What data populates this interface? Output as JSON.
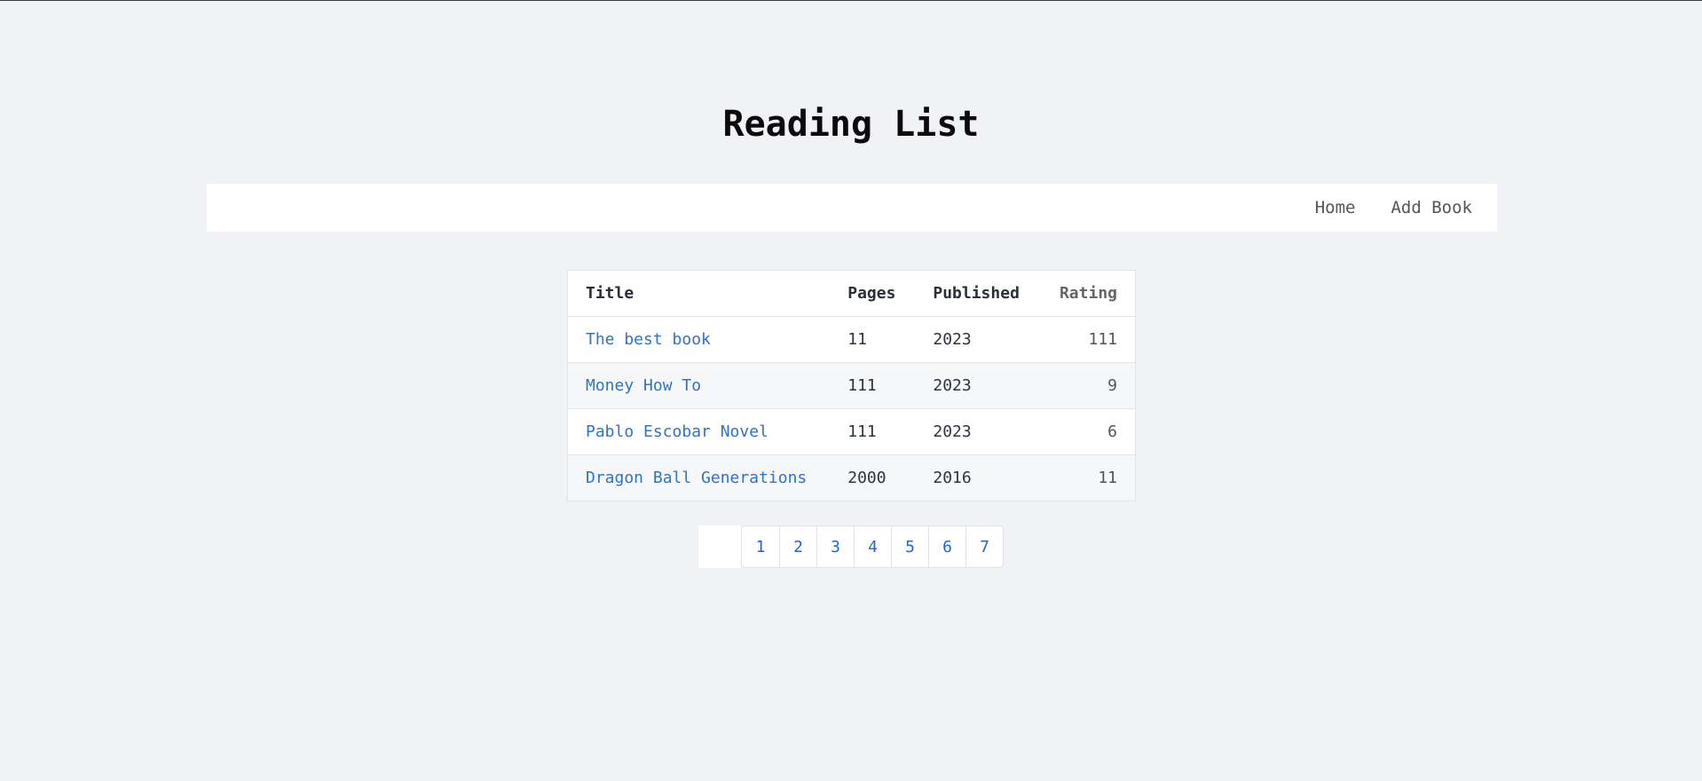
{
  "header": {
    "title": "Reading List"
  },
  "nav": {
    "links": [
      {
        "label": "Home"
      },
      {
        "label": "Add Book"
      }
    ]
  },
  "table": {
    "columns": {
      "title": "Title",
      "pages": "Pages",
      "published": "Published",
      "rating": "Rating"
    },
    "rows": [
      {
        "title": "The best book",
        "pages": "11",
        "published": "2023",
        "rating": "111"
      },
      {
        "title": "Money How To",
        "pages": "111",
        "published": "2023",
        "rating": "9"
      },
      {
        "title": "Pablo Escobar Novel",
        "pages": "111",
        "published": "2023",
        "rating": "6"
      },
      {
        "title": "Dragon Ball Generations",
        "pages": "2000",
        "published": "2016",
        "rating": "11"
      }
    ]
  },
  "pagination": {
    "pages": [
      "1",
      "2",
      "3",
      "4",
      "5",
      "6",
      "7"
    ]
  },
  "colors": {
    "background": "#f1f2f5",
    "link": "#2f73c9",
    "page_link": "#1f66d6"
  }
}
